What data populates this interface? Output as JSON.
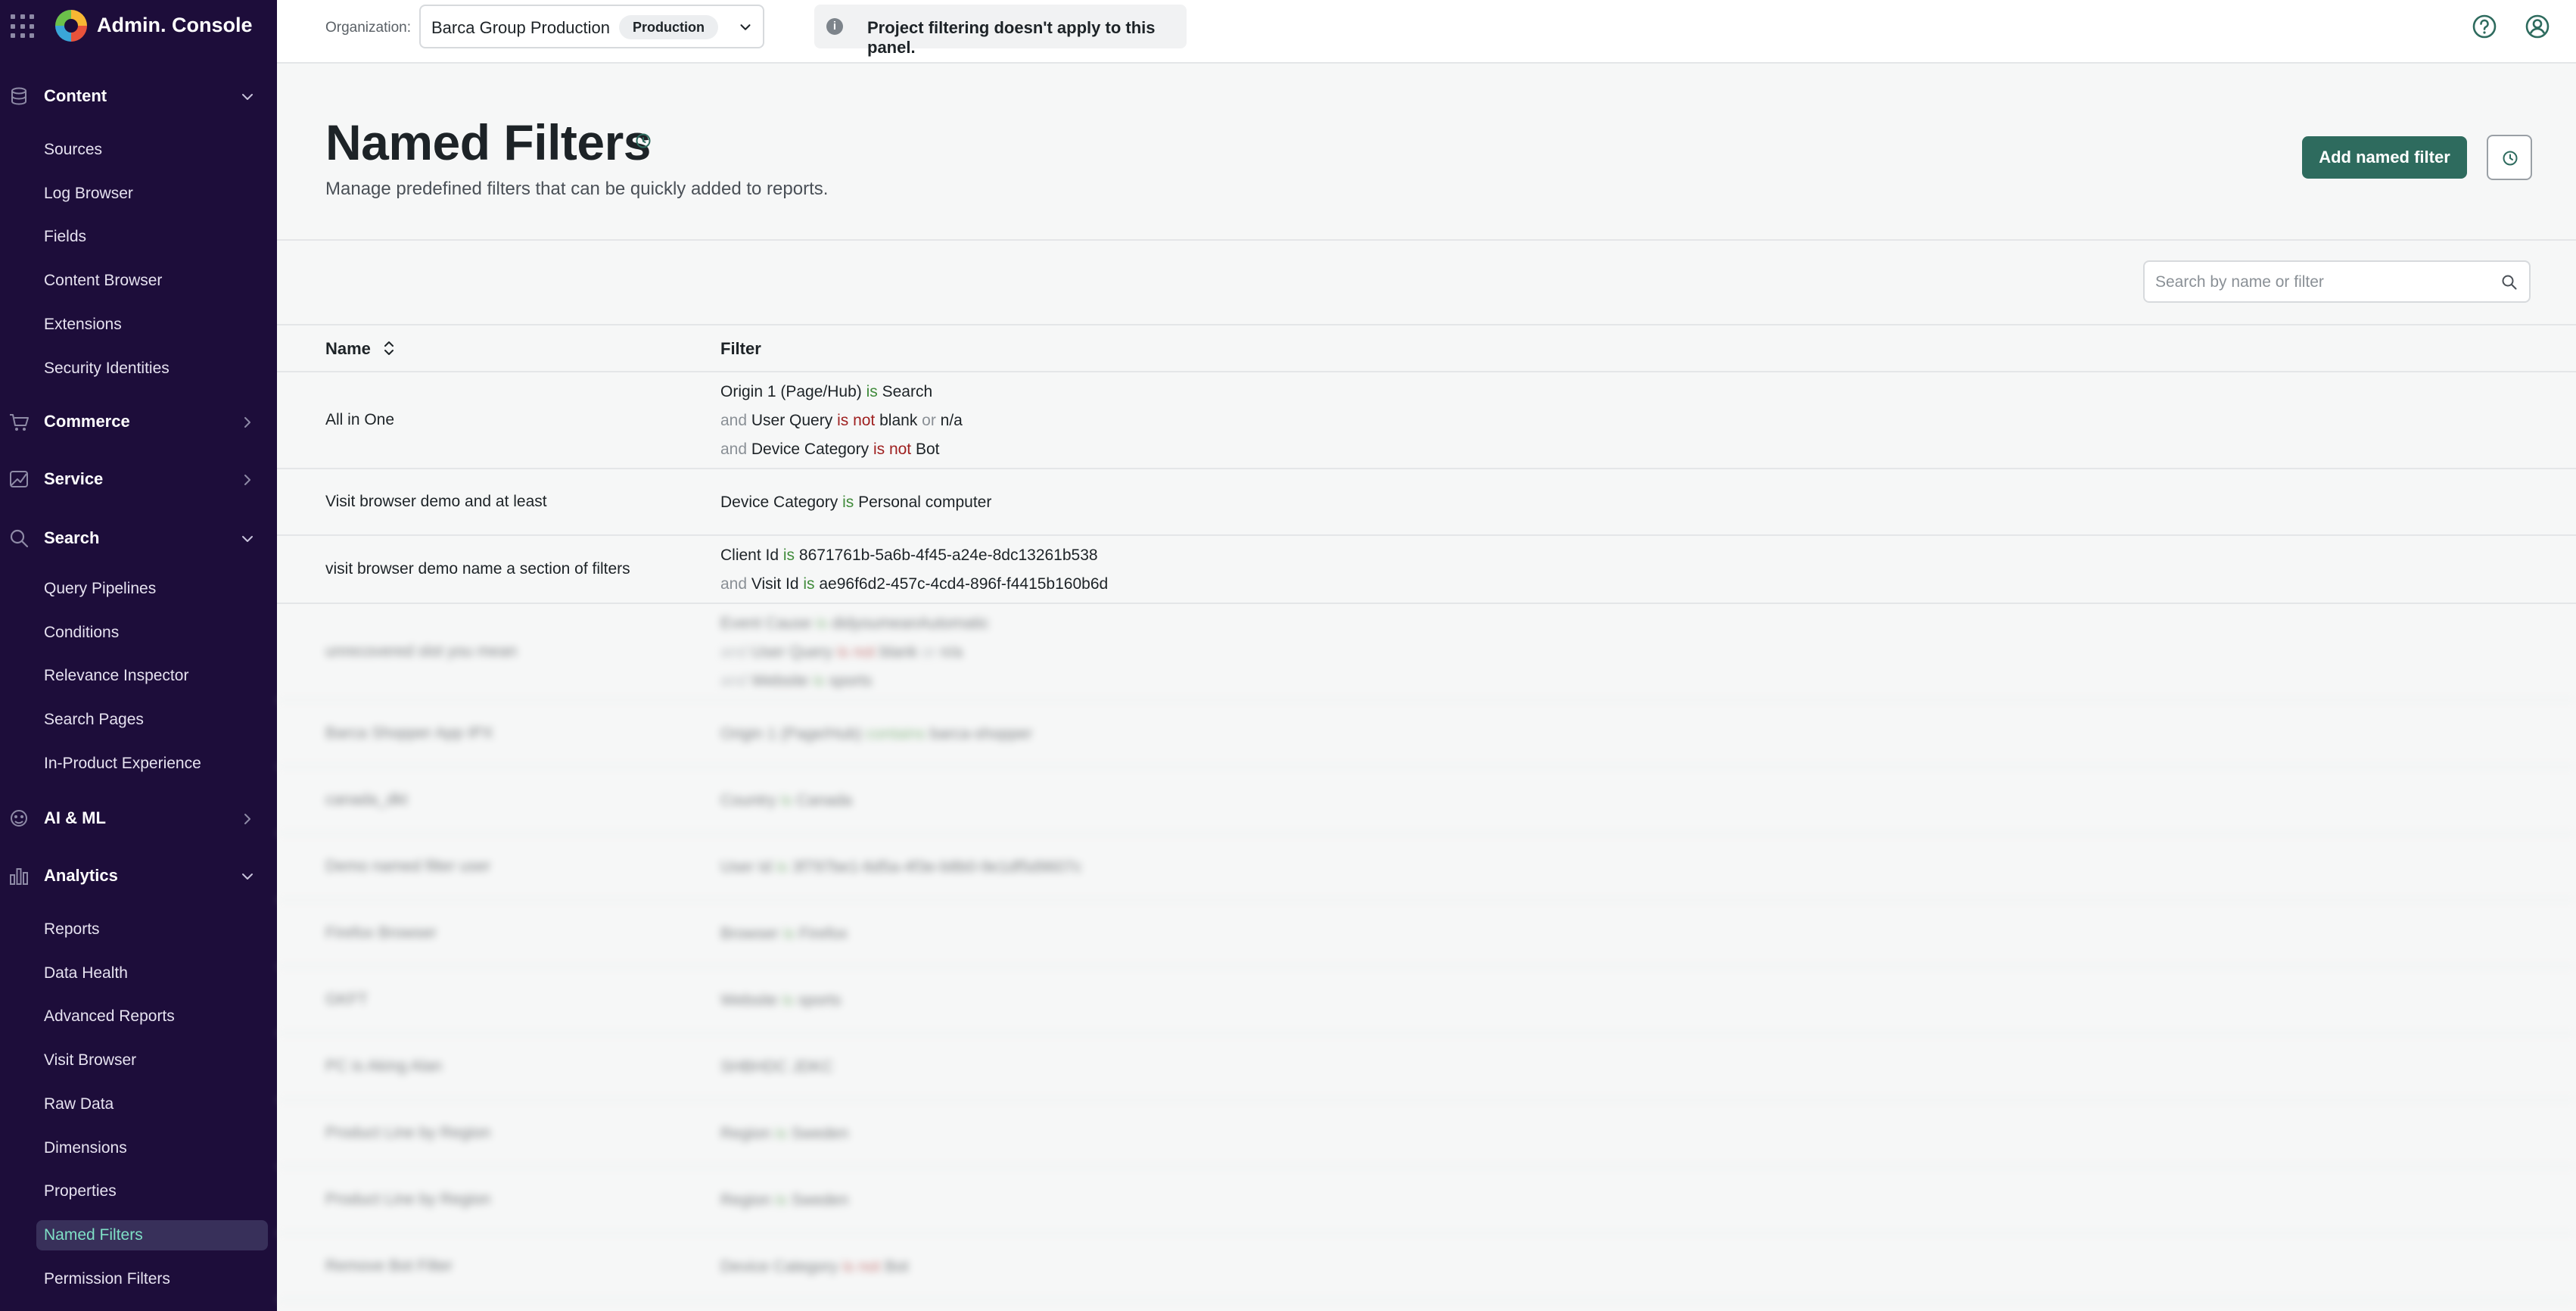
{
  "app": {
    "title": "Admin. Console"
  },
  "sidebar": {
    "sections": [
      {
        "label": "Content",
        "icon": "database-icon",
        "expanded": true,
        "items": [
          "Sources",
          "Log Browser",
          "Fields",
          "Content Browser",
          "Extensions",
          "Security Identities"
        ]
      },
      {
        "label": "Commerce",
        "icon": "cart-icon",
        "expanded": false,
        "items": []
      },
      {
        "label": "Service",
        "icon": "service-icon",
        "expanded": false,
        "items": []
      },
      {
        "label": "Search",
        "icon": "search-icon",
        "expanded": true,
        "items": [
          "Query Pipelines",
          "Conditions",
          "Relevance Inspector",
          "Search Pages",
          "In-Product Experience"
        ]
      },
      {
        "label": "AI & ML",
        "icon": "ai-icon",
        "expanded": false,
        "items": []
      },
      {
        "label": "Analytics",
        "icon": "bar-chart-icon",
        "expanded": true,
        "items": [
          "Reports",
          "Data Health",
          "Advanced Reports",
          "Visit Browser",
          "Raw Data",
          "Dimensions",
          "Properties",
          "Named Filters",
          "Permission Filters"
        ]
      }
    ],
    "active_item": "Named Filters"
  },
  "topbar": {
    "org_label": "Organization:",
    "org_name": "Barca Group Production",
    "org_badge": "Production",
    "notice": "Project filtering doesn't apply to this panel."
  },
  "header": {
    "title": "Named Filters",
    "description": "Manage predefined filters that can be quickly added to reports.",
    "add_button": "Add named filter"
  },
  "search": {
    "placeholder": "Search by name or filter"
  },
  "table": {
    "columns": {
      "name": "Name",
      "filter": "Filter"
    },
    "rows": [
      {
        "name": "All in One",
        "blurred": false,
        "lines": [
          [
            {
              "t": "Origin 1 (Page/Hub)",
              "c": ""
            },
            {
              "t": " is ",
              "c": "op-is"
            },
            {
              "t": "Search",
              "c": ""
            }
          ],
          [
            {
              "t": "and ",
              "c": "conj"
            },
            {
              "t": "User Query",
              "c": ""
            },
            {
              "t": " is not ",
              "c": "op-not"
            },
            {
              "t": "blank",
              "c": ""
            },
            {
              "t": " or ",
              "c": "conj"
            },
            {
              "t": "n/a",
              "c": ""
            }
          ],
          [
            {
              "t": "and ",
              "c": "conj"
            },
            {
              "t": "Device Category",
              "c": ""
            },
            {
              "t": " is not ",
              "c": "op-not"
            },
            {
              "t": "Bot",
              "c": ""
            }
          ]
        ]
      },
      {
        "name": "Visit browser demo and at least",
        "blurred": false,
        "lines": [
          [
            {
              "t": "Device Category",
              "c": ""
            },
            {
              "t": " is ",
              "c": "op-is"
            },
            {
              "t": "Personal computer",
              "c": ""
            }
          ]
        ]
      },
      {
        "name": "visit browser demo name a section of filters",
        "blurred": false,
        "lines": [
          [
            {
              "t": "Client Id",
              "c": ""
            },
            {
              "t": " is ",
              "c": "op-is"
            },
            {
              "t": "8671761b-5a6b-4f45-a24e-8dc13261b538",
              "c": ""
            }
          ],
          [
            {
              "t": "and ",
              "c": "conj"
            },
            {
              "t": "Visit Id",
              "c": ""
            },
            {
              "t": " is ",
              "c": "op-is"
            },
            {
              "t": "ae96f6d2-457c-4cd4-896f-f4415b160b6d",
              "c": ""
            }
          ]
        ]
      },
      {
        "name": "unrecovered slot you mean",
        "blurred": true,
        "lines": [
          [
            {
              "t": "Event Cause",
              "c": ""
            },
            {
              "t": " is ",
              "c": "op-is"
            },
            {
              "t": "didyoumeanAutomatic",
              "c": ""
            }
          ],
          [
            {
              "t": "and ",
              "c": "conj"
            },
            {
              "t": "User Query",
              "c": ""
            },
            {
              "t": " is not ",
              "c": "op-not"
            },
            {
              "t": "blank",
              "c": ""
            },
            {
              "t": " or ",
              "c": "conj"
            },
            {
              "t": "n/a",
              "c": ""
            }
          ],
          [
            {
              "t": "and ",
              "c": "conj"
            },
            {
              "t": "Website",
              "c": ""
            },
            {
              "t": " is ",
              "c": "op-is"
            },
            {
              "t": "sports",
              "c": ""
            }
          ]
        ]
      },
      {
        "name": "Barca Shopper App IPX",
        "blurred": true,
        "lines": [
          [
            {
              "t": "Origin 1 (Page/Hub)",
              "c": ""
            },
            {
              "t": " contains ",
              "c": "op-is"
            },
            {
              "t": "barca-shopper",
              "c": ""
            }
          ]
        ]
      },
      {
        "name": "canada_dkt",
        "blurred": true,
        "lines": [
          [
            {
              "t": "Country",
              "c": ""
            },
            {
              "t": " is ",
              "c": "op-is"
            },
            {
              "t": "Canada",
              "c": ""
            }
          ]
        ]
      },
      {
        "name": "Demo named filter user",
        "blurred": true,
        "lines": [
          [
            {
              "t": "User Id",
              "c": ""
            },
            {
              "t": " is ",
              "c": "op-is"
            },
            {
              "t": "3f797be1-6d5a-4f3e-b8b0-9e1df5d9607c",
              "c": ""
            }
          ]
        ]
      },
      {
        "name": "Firefox Browser",
        "blurred": true,
        "lines": [
          [
            {
              "t": "Browser",
              "c": ""
            },
            {
              "t": " is ",
              "c": "op-is"
            },
            {
              "t": "Firefox",
              "c": ""
            }
          ]
        ]
      },
      {
        "name": "GKFT",
        "blurred": true,
        "lines": [
          [
            {
              "t": "Website",
              "c": ""
            },
            {
              "t": " is ",
              "c": "op-is"
            },
            {
              "t": "sports",
              "c": ""
            }
          ]
        ]
      },
      {
        "name": "PC is Aking Alan",
        "blurred": true,
        "lines": [
          [
            {
              "t": "SHBHDC JDKC",
              "c": ""
            }
          ]
        ]
      },
      {
        "name": "Product Line by Region",
        "blurred": true,
        "lines": [
          [
            {
              "t": "Region",
              "c": ""
            },
            {
              "t": " is ",
              "c": "op-is"
            },
            {
              "t": "Sweden",
              "c": ""
            }
          ]
        ]
      },
      {
        "name": "Product Line by Region",
        "blurred": true,
        "lines": [
          [
            {
              "t": "Region",
              "c": ""
            },
            {
              "t": " is ",
              "c": "op-is"
            },
            {
              "t": "Sweden",
              "c": ""
            }
          ]
        ]
      },
      {
        "name": "Remove Bot Filter",
        "blurred": true,
        "lines": [
          [
            {
              "t": "Device Category",
              "c": ""
            },
            {
              "t": " is not ",
              "c": "op-not"
            },
            {
              "t": "Bot",
              "c": ""
            }
          ]
        ]
      }
    ]
  },
  "colors": {
    "sidebar_bg": "#1d0d3a",
    "accent": "#2e6b5e",
    "active_text": "#7fe0c6",
    "op_is": "#3f8a3a",
    "op_not": "#9e1f1f"
  }
}
